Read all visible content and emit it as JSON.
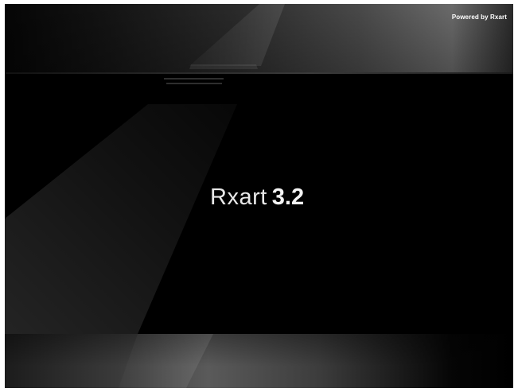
{
  "splash": {
    "powered_by": "Powered by Rxart",
    "product_name": "Rxart",
    "version": "3.2"
  },
  "colors": {
    "background": "#000000",
    "frame": "#ffffff",
    "logo_text": "#e8e8e8",
    "band_highlight": "#6a6a6a"
  }
}
